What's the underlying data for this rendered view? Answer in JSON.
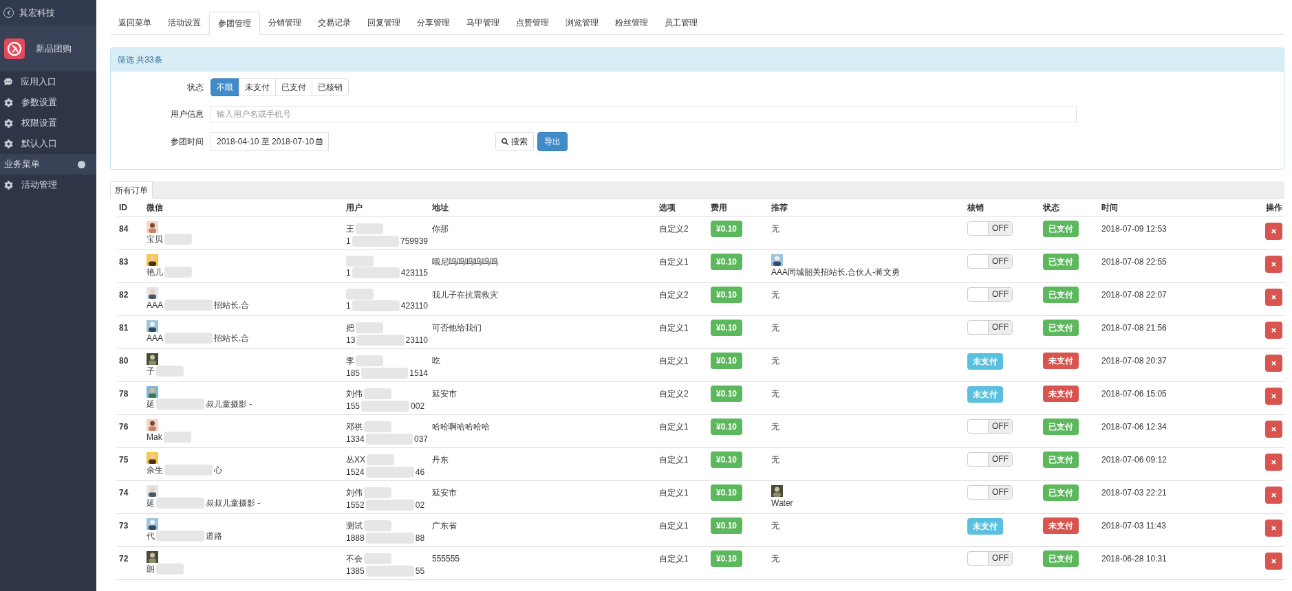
{
  "sidebar": {
    "company": "其宏科技",
    "app": "新品团购",
    "items": [
      {
        "label": "应用入口",
        "kind": "chat"
      },
      {
        "label": "参数设置",
        "kind": "gear"
      },
      {
        "label": "权限设置",
        "kind": "gear"
      },
      {
        "label": "默认入口",
        "kind": "gear"
      }
    ],
    "section": "业务菜单",
    "section_items": [
      {
        "label": "活动管理",
        "kind": "gear"
      }
    ]
  },
  "tabs": [
    {
      "label": "返回菜单",
      "selected": false
    },
    {
      "label": "活动设置",
      "selected": false
    },
    {
      "label": "参团管理",
      "selected": true
    },
    {
      "label": "分销管理",
      "selected": false
    },
    {
      "label": "交易记录",
      "selected": false
    },
    {
      "label": "回复管理",
      "selected": false
    },
    {
      "label": "分享管理",
      "selected": false
    },
    {
      "label": "马甲管理",
      "selected": false
    },
    {
      "label": "点赞管理",
      "selected": false
    },
    {
      "label": "浏览管理",
      "selected": false
    },
    {
      "label": "粉丝管理",
      "selected": false
    },
    {
      "label": "员工管理",
      "selected": false
    }
  ],
  "filter": {
    "heading": "筛选 共33条",
    "status_label": "状态",
    "status_options": [
      {
        "label": "不限",
        "selected": true
      },
      {
        "label": "未支付",
        "selected": false
      },
      {
        "label": "已支付",
        "selected": false
      },
      {
        "label": "已核销",
        "selected": false
      }
    ],
    "user_label": "用户信息",
    "user_placeholder": "输入用户名或手机号",
    "time_label": "参团时间",
    "date_range": "2018-04-10 至 2018-07-10",
    "search_button": "搜索",
    "export_button": "导出"
  },
  "orders_tab": "所有订单",
  "table": {
    "columns": [
      "ID",
      "微信",
      "用户",
      "地址",
      "选项",
      "费用",
      "推荐",
      "核销",
      "状态",
      "时间",
      "操作"
    ],
    "rows": [
      {
        "id": "84",
        "wechat": [
          "宝贝"
        ],
        "name": [
          "王"
        ],
        "phone": [
          "1",
          "759939"
        ],
        "address": "你那",
        "option": "自定义2",
        "fee": "¥0.10",
        "referrer": {
          "kind": "none",
          "text": "无"
        },
        "verify": {
          "kind": "toggle",
          "on": false,
          "label": "OFF"
        },
        "status": {
          "label": "已支付",
          "paid": true
        },
        "time": "2018-07-09 12:53"
      },
      {
        "id": "83",
        "wechat": [
          "艳儿"
        ],
        "name": [],
        "phone": [
          "1",
          "423115"
        ],
        "address": "哦尼呜呜呜呜呜呜",
        "option": "自定义1",
        "fee": "¥0.10",
        "referrer": {
          "kind": "user",
          "text": "AAA同城韶关招站长.合伙人-蒋文勇"
        },
        "verify": {
          "kind": "toggle",
          "on": false,
          "label": "OFF"
        },
        "status": {
          "label": "已支付",
          "paid": true
        },
        "time": "2018-07-08 22:55"
      },
      {
        "id": "82",
        "wechat": [
          "AAA",
          "招站长.合"
        ],
        "name": [],
        "phone": [
          "1",
          "423110"
        ],
        "address": "我儿子在抗震救灾",
        "option": "自定义2",
        "fee": "¥0.10",
        "referrer": {
          "kind": "none",
          "text": "无"
        },
        "verify": {
          "kind": "toggle",
          "on": false,
          "label": "OFF"
        },
        "status": {
          "label": "已支付",
          "paid": true
        },
        "time": "2018-07-08 22:07"
      },
      {
        "id": "81",
        "wechat": [
          "AAA",
          "招站长.合"
        ],
        "name": [
          "把"
        ],
        "phone": [
          "13",
          "23110"
        ],
        "address": "可否他给我们",
        "option": "自定义1",
        "fee": "¥0.10",
        "referrer": {
          "kind": "none",
          "text": "无"
        },
        "verify": {
          "kind": "toggle",
          "on": false,
          "label": "OFF"
        },
        "status": {
          "label": "已支付",
          "paid": true
        },
        "time": "2018-07-08 21:56"
      },
      {
        "id": "80",
        "wechat": [
          "子"
        ],
        "name": [
          "李"
        ],
        "phone": [
          "185",
          "1514"
        ],
        "address": "吃",
        "option": "自定义1",
        "fee": "¥0.10",
        "referrer": {
          "kind": "none",
          "text": "无"
        },
        "verify": {
          "kind": "badge",
          "label": "未支付"
        },
        "status": {
          "label": "未支付",
          "paid": false
        },
        "time": "2018-07-08 20:37"
      },
      {
        "id": "78",
        "wechat": [
          "延",
          "叔儿童摄影 -"
        ],
        "name": [
          "刘伟"
        ],
        "phone": [
          "155",
          "002"
        ],
        "address": "延安市",
        "option": "自定义2",
        "fee": "¥0.10",
        "referrer": {
          "kind": "none",
          "text": "无"
        },
        "verify": {
          "kind": "badge",
          "label": "未支付"
        },
        "status": {
          "label": "未支付",
          "paid": false
        },
        "time": "2018-07-06 15:05"
      },
      {
        "id": "76",
        "wechat": [
          "Mak"
        ],
        "name": [
          "邓祺"
        ],
        "phone": [
          "1334",
          "037"
        ],
        "address": "哈哈啊哈哈哈哈",
        "option": "自定义1",
        "fee": "¥0.10",
        "referrer": {
          "kind": "none",
          "text": "无"
        },
        "verify": {
          "kind": "toggle",
          "on": false,
          "label": "OFF"
        },
        "status": {
          "label": "已支付",
          "paid": true
        },
        "time": "2018-07-06 12:34"
      },
      {
        "id": "75",
        "wechat": [
          "余生",
          "心"
        ],
        "name": [
          "丛XX"
        ],
        "phone": [
          "1524",
          "46"
        ],
        "address": "丹东",
        "option": "自定义1",
        "fee": "¥0.10",
        "referrer": {
          "kind": "none",
          "text": "无"
        },
        "verify": {
          "kind": "toggle",
          "on": false,
          "label": "OFF"
        },
        "status": {
          "label": "已支付",
          "paid": true
        },
        "time": "2018-07-06 09:12"
      },
      {
        "id": "74",
        "wechat": [
          "延",
          "叔叔儿童摄影 -"
        ],
        "name": [
          "刘伟"
        ],
        "phone": [
          "1552",
          "02"
        ],
        "address": "延安市",
        "option": "自定义1",
        "fee": "¥0.10",
        "referrer": {
          "kind": "user",
          "text": "Water"
        },
        "verify": {
          "kind": "toggle",
          "on": false,
          "label": "OFF"
        },
        "status": {
          "label": "已支付",
          "paid": true
        },
        "time": "2018-07-03 22:21"
      },
      {
        "id": "73",
        "wechat": [
          "代",
          "道路"
        ],
        "name": [
          "测试"
        ],
        "phone": [
          "1888",
          "88"
        ],
        "address": "广东省",
        "option": "自定义1",
        "fee": "¥0.10",
        "referrer": {
          "kind": "none",
          "text": "无"
        },
        "verify": {
          "kind": "badge",
          "label": "未支付"
        },
        "status": {
          "label": "未支付",
          "paid": false
        },
        "time": "2018-07-03 11:43"
      },
      {
        "id": "72",
        "wechat": [
          "朗"
        ],
        "name": [
          "不会"
        ],
        "phone": [
          "1385",
          "55"
        ],
        "address": "555555",
        "option": "自定义1",
        "fee": "¥0.10",
        "referrer": {
          "kind": "none",
          "text": "无"
        },
        "verify": {
          "kind": "toggle",
          "on": false,
          "label": "OFF"
        },
        "status": {
          "label": "已支付",
          "paid": true
        },
        "time": "2018-06-28 10:31"
      }
    ]
  }
}
